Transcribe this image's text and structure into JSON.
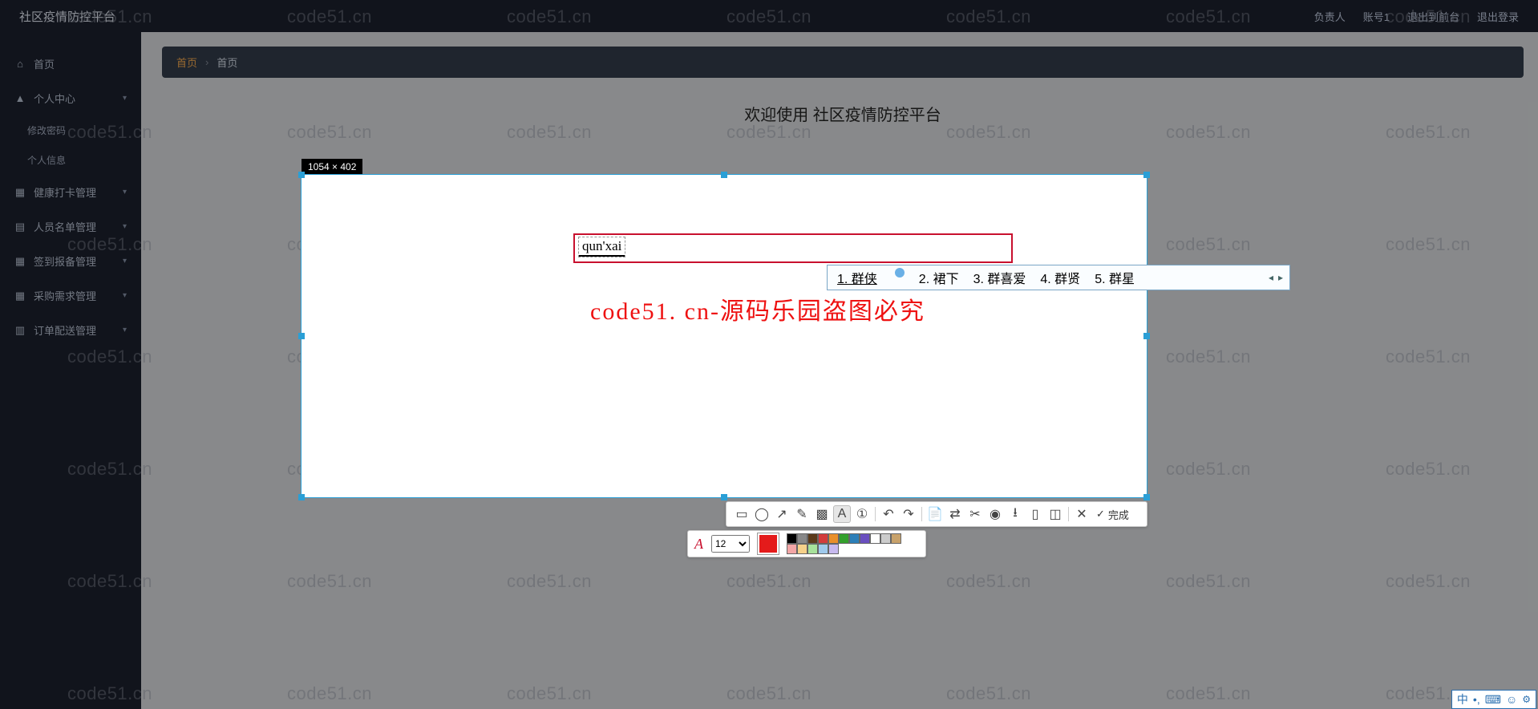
{
  "header": {
    "title": "社区疫情防控平台",
    "role_label": "负责人",
    "account_label": "账号1",
    "exit_front": "退出到前台",
    "logout": "退出登录"
  },
  "sidebar": {
    "home": "首页",
    "personal_center": "个人中心",
    "subs": {
      "change_password": "修改密码",
      "personal_info": "个人信息"
    },
    "health_checkin": "健康打卡管理",
    "person_list": "人员名单管理",
    "checkin_report": "签到报备管理",
    "purchase_demand": "采购需求管理",
    "order_delivery": "订单配送管理"
  },
  "breadcrumb": {
    "home": "首页",
    "current": "首页"
  },
  "welcome": "欢迎使用  社区疫情防控平台",
  "selection": {
    "dimensions_label": "1054 × 402"
  },
  "textbox": {
    "value": "qun'xai"
  },
  "big_watermark": "code51. cn-源码乐园盗图必究",
  "ime": {
    "candidates": [
      {
        "n": "1.",
        "t": "群侠"
      },
      {
        "n": "2.",
        "t": "裙下"
      },
      {
        "n": "3.",
        "t": "群喜爱"
      },
      {
        "n": "4.",
        "t": "群贤"
      },
      {
        "n": "5.",
        "t": "群星"
      }
    ]
  },
  "toolbar": {
    "done": "完成"
  },
  "textpanel": {
    "font_size": "12",
    "big_swatch": "#e41b1b",
    "swatches": [
      "#000000",
      "#888888",
      "#5b3a1a",
      "#d23b3b",
      "#e98f2a",
      "#33a02c",
      "#2c7fb8",
      "#6a4fbf",
      "#ffffff",
      "#cccccc",
      "#c8a26b",
      "#f3a6a6",
      "#f6d18a",
      "#a7e29b",
      "#9fc9ec",
      "#c7b9ef"
    ]
  },
  "watermark_text": "code51.cn",
  "ime_status": {
    "lang": "中"
  }
}
